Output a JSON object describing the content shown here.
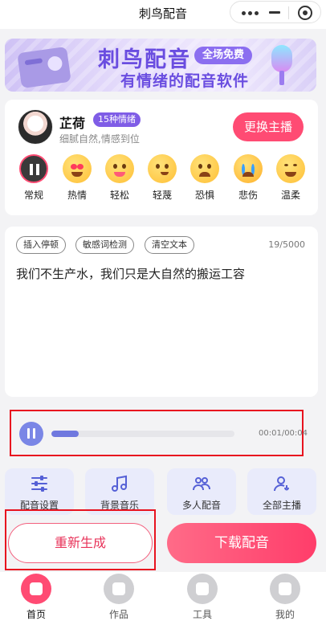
{
  "app": {
    "title": "刺鸟配音"
  },
  "banner": {
    "name": "刺鸟配音",
    "free_tag": "全场免费",
    "slogan": "有情绪的配音软件"
  },
  "anchor": {
    "name": "芷荷",
    "emotion_tag": "15种情绪",
    "description": "细腻自然,情感到位",
    "switch_label": "更换主播"
  },
  "emotions": [
    {
      "label": "常规",
      "icon": "pause-face-icon",
      "active": true
    },
    {
      "label": "热情",
      "icon": "heart-eyes-face-icon"
    },
    {
      "label": "轻松",
      "icon": "tongue-face-icon"
    },
    {
      "label": "轻蔑",
      "icon": "smirk-face-icon"
    },
    {
      "label": "恐惧",
      "icon": "fearful-face-icon"
    },
    {
      "label": "悲伤",
      "icon": "crying-face-icon"
    },
    {
      "label": "温柔",
      "icon": "smiling-face-icon"
    }
  ],
  "editor": {
    "chips": [
      "插入停顿",
      "敏感词检测",
      "清空文本"
    ],
    "counter": "19/5000",
    "text": "我们不生产水，我们只是大自然的搬运工容"
  },
  "player": {
    "time": "00:01/00:04",
    "progress": 0.15
  },
  "tools": [
    {
      "label": "配音设置",
      "icon": "sliders-icon"
    },
    {
      "label": "背景音乐",
      "icon": "music-note-icon"
    },
    {
      "label": "多人配音",
      "icon": "people-icon"
    },
    {
      "label": "全部主播",
      "icon": "voice-user-icon"
    }
  ],
  "actions": {
    "regenerate": "重新生成",
    "download": "下载配音"
  },
  "tabs": [
    {
      "label": "首页",
      "active": true
    },
    {
      "label": "作品"
    },
    {
      "label": "工具"
    },
    {
      "label": "我的"
    }
  ],
  "colors": {
    "primary": "#ff4b73",
    "accent": "#6f78df",
    "highlight_box": "#e8131f"
  }
}
